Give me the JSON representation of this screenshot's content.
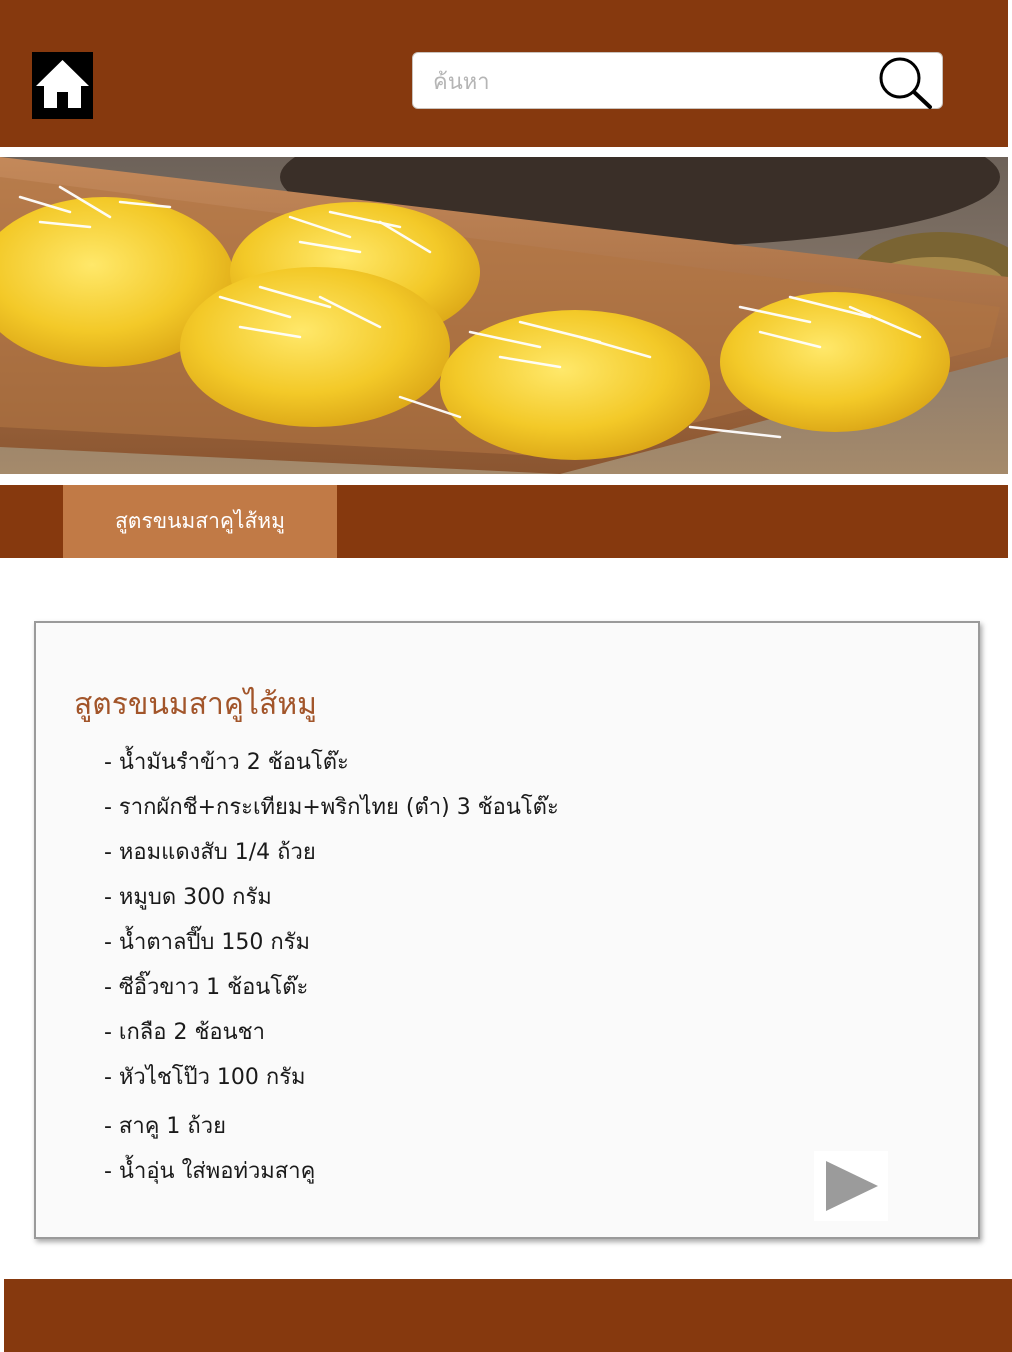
{
  "header": {
    "home_icon": "home-icon",
    "search": {
      "placeholder": "ค้นหา",
      "value": "",
      "icon": "search-icon"
    }
  },
  "hero": {
    "image": "coconut-topped yellow sweets on wooden tray"
  },
  "nav": {
    "active_tab": "สูตรขนมสาคูไส้หมู"
  },
  "recipe": {
    "title": "สูตรขนมสาคูไส้หมู",
    "ingredients": [
      "- น้ำมันรำข้าว 2 ช้อนโต๊ะ",
      "- รากผักชี+กระเทียม+พริกไทย (ตำ) 3 ช้อนโต๊ะ",
      "- หอมแดงสับ 1/4 ถ้วย",
      "- หมูบด 300 กรัม",
      "- น้ำตาลปี๊บ 150 กรัม",
      "- ซีอิ๊วขาว 1 ช้อนโต๊ะ",
      "- เกลือ 2 ช้อนชา",
      "- หัวไชโป๊ว 100 กรัม",
      "- สาคู 1 ถ้วย",
      "-  น้ำอุ่น ใส่พอท่วมสาคู"
    ],
    "play_icon": "play-icon"
  },
  "colors": {
    "brand_brown": "#86390e",
    "tab_active": "#c17a46",
    "title_text": "#a2552a"
  }
}
